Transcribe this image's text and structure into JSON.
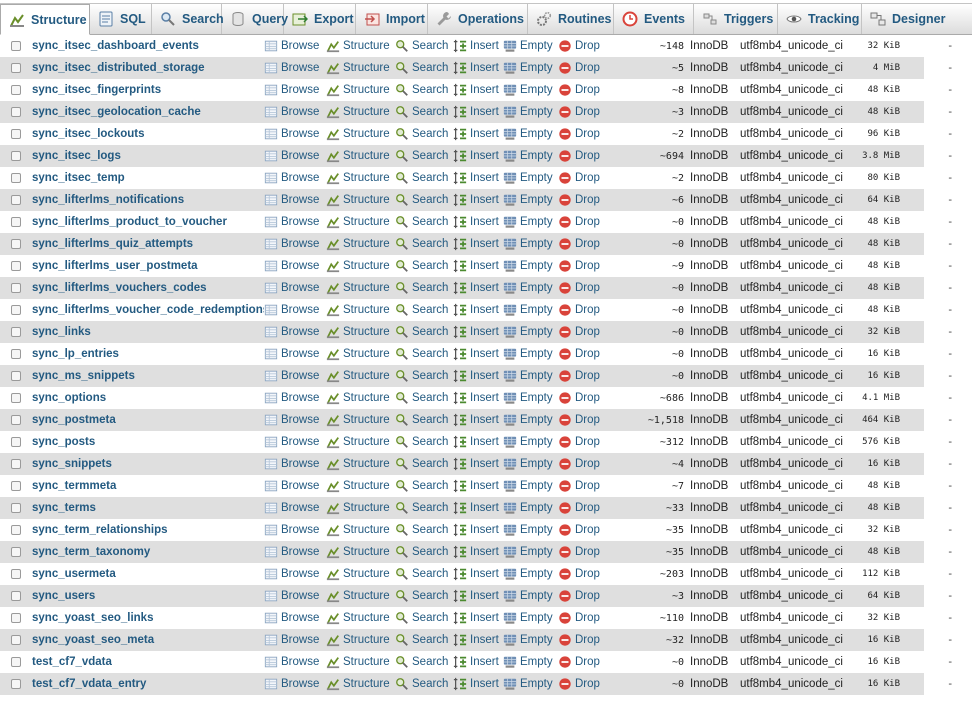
{
  "tabs": [
    {
      "label": "Structure",
      "icon": "structure-icon",
      "active": true
    },
    {
      "label": "SQL",
      "icon": "sql-icon"
    },
    {
      "label": "Search",
      "icon": "search-icon"
    },
    {
      "label": "Query",
      "icon": "query-icon"
    },
    {
      "label": "Export",
      "icon": "export-icon"
    },
    {
      "label": "Import",
      "icon": "import-icon"
    },
    {
      "label": "Operations",
      "icon": "wrench-icon"
    },
    {
      "label": "Routines",
      "icon": "gears-icon"
    },
    {
      "label": "Events",
      "icon": "clock-icon"
    },
    {
      "label": "Triggers",
      "icon": "triggers-icon"
    },
    {
      "label": "Tracking",
      "icon": "eye-icon"
    },
    {
      "label": "Designer",
      "icon": "designer-icon"
    }
  ],
  "actions": {
    "browse": "Browse",
    "structure": "Structure",
    "search": "Search",
    "insert": "Insert",
    "empty": "Empty",
    "drop": "Drop"
  },
  "colors": {
    "link": "#235a81",
    "row_alt": "#dfdfdf",
    "drop_red": "#d9433a"
  },
  "tables": [
    {
      "name": "sync_itsec_dashboard_events",
      "rows": "~148",
      "engine": "InnoDB",
      "collation": "utf8mb4_unicode_ci",
      "size": "32 KiB",
      "overhead": "-"
    },
    {
      "name": "sync_itsec_distributed_storage",
      "rows": "~5",
      "engine": "InnoDB",
      "collation": "utf8mb4_unicode_ci",
      "size": "4 MiB",
      "overhead": "-"
    },
    {
      "name": "sync_itsec_fingerprints",
      "rows": "~8",
      "engine": "InnoDB",
      "collation": "utf8mb4_unicode_ci",
      "size": "48 KiB",
      "overhead": "-"
    },
    {
      "name": "sync_itsec_geolocation_cache",
      "rows": "~3",
      "engine": "InnoDB",
      "collation": "utf8mb4_unicode_ci",
      "size": "48 KiB",
      "overhead": "-"
    },
    {
      "name": "sync_itsec_lockouts",
      "rows": "~2",
      "engine": "InnoDB",
      "collation": "utf8mb4_unicode_ci",
      "size": "96 KiB",
      "overhead": "-"
    },
    {
      "name": "sync_itsec_logs",
      "rows": "~694",
      "engine": "InnoDB",
      "collation": "utf8mb4_unicode_ci",
      "size": "3.8 MiB",
      "overhead": "-"
    },
    {
      "name": "sync_itsec_temp",
      "rows": "~2",
      "engine": "InnoDB",
      "collation": "utf8mb4_unicode_ci",
      "size": "80 KiB",
      "overhead": "-"
    },
    {
      "name": "sync_lifterlms_notifications",
      "rows": "~6",
      "engine": "InnoDB",
      "collation": "utf8mb4_unicode_ci",
      "size": "64 KiB",
      "overhead": "-"
    },
    {
      "name": "sync_lifterlms_product_to_voucher",
      "rows": "~0",
      "engine": "InnoDB",
      "collation": "utf8mb4_unicode_ci",
      "size": "48 KiB",
      "overhead": "-"
    },
    {
      "name": "sync_lifterlms_quiz_attempts",
      "rows": "~0",
      "engine": "InnoDB",
      "collation": "utf8mb4_unicode_ci",
      "size": "48 KiB",
      "overhead": "-"
    },
    {
      "name": "sync_lifterlms_user_postmeta",
      "rows": "~9",
      "engine": "InnoDB",
      "collation": "utf8mb4_unicode_ci",
      "size": "48 KiB",
      "overhead": "-"
    },
    {
      "name": "sync_lifterlms_vouchers_codes",
      "rows": "~0",
      "engine": "InnoDB",
      "collation": "utf8mb4_unicode_ci",
      "size": "48 KiB",
      "overhead": "-"
    },
    {
      "name": "sync_lifterlms_voucher_code_redemptions",
      "rows": "~0",
      "engine": "InnoDB",
      "collation": "utf8mb4_unicode_ci",
      "size": "48 KiB",
      "overhead": "-"
    },
    {
      "name": "sync_links",
      "rows": "~0",
      "engine": "InnoDB",
      "collation": "utf8mb4_unicode_ci",
      "size": "32 KiB",
      "overhead": "-"
    },
    {
      "name": "sync_lp_entries",
      "rows": "~0",
      "engine": "InnoDB",
      "collation": "utf8mb4_unicode_ci",
      "size": "16 KiB",
      "overhead": "-"
    },
    {
      "name": "sync_ms_snippets",
      "rows": "~0",
      "engine": "InnoDB",
      "collation": "utf8mb4_unicode_ci",
      "size": "16 KiB",
      "overhead": "-"
    },
    {
      "name": "sync_options",
      "rows": "~686",
      "engine": "InnoDB",
      "collation": "utf8mb4_unicode_ci",
      "size": "4.1 MiB",
      "overhead": "-"
    },
    {
      "name": "sync_postmeta",
      "rows": "~1,518",
      "engine": "InnoDB",
      "collation": "utf8mb4_unicode_ci",
      "size": "464 KiB",
      "overhead": "-"
    },
    {
      "name": "sync_posts",
      "rows": "~312",
      "engine": "InnoDB",
      "collation": "utf8mb4_unicode_ci",
      "size": "576 KiB",
      "overhead": "-"
    },
    {
      "name": "sync_snippets",
      "rows": "~4",
      "engine": "InnoDB",
      "collation": "utf8mb4_unicode_ci",
      "size": "16 KiB",
      "overhead": "-"
    },
    {
      "name": "sync_termmeta",
      "rows": "~7",
      "engine": "InnoDB",
      "collation": "utf8mb4_unicode_ci",
      "size": "48 KiB",
      "overhead": "-"
    },
    {
      "name": "sync_terms",
      "rows": "~33",
      "engine": "InnoDB",
      "collation": "utf8mb4_unicode_ci",
      "size": "48 KiB",
      "overhead": "-"
    },
    {
      "name": "sync_term_relationships",
      "rows": "~35",
      "engine": "InnoDB",
      "collation": "utf8mb4_unicode_ci",
      "size": "32 KiB",
      "overhead": "-"
    },
    {
      "name": "sync_term_taxonomy",
      "rows": "~35",
      "engine": "InnoDB",
      "collation": "utf8mb4_unicode_ci",
      "size": "48 KiB",
      "overhead": "-"
    },
    {
      "name": "sync_usermeta",
      "rows": "~203",
      "engine": "InnoDB",
      "collation": "utf8mb4_unicode_ci",
      "size": "112 KiB",
      "overhead": "-"
    },
    {
      "name": "sync_users",
      "rows": "~3",
      "engine": "InnoDB",
      "collation": "utf8mb4_unicode_ci",
      "size": "64 KiB",
      "overhead": "-"
    },
    {
      "name": "sync_yoast_seo_links",
      "rows": "~110",
      "engine": "InnoDB",
      "collation": "utf8mb4_unicode_ci",
      "size": "32 KiB",
      "overhead": "-"
    },
    {
      "name": "sync_yoast_seo_meta",
      "rows": "~32",
      "engine": "InnoDB",
      "collation": "utf8mb4_unicode_ci",
      "size": "16 KiB",
      "overhead": "-"
    },
    {
      "name": "test_cf7_vdata",
      "rows": "~0",
      "engine": "InnoDB",
      "collation": "utf8mb4_unicode_ci",
      "size": "16 KiB",
      "overhead": "-"
    },
    {
      "name": "test_cf7_vdata_entry",
      "rows": "~0",
      "engine": "InnoDB",
      "collation": "utf8mb4_unicode_ci",
      "size": "16 KiB",
      "overhead": "-"
    }
  ]
}
